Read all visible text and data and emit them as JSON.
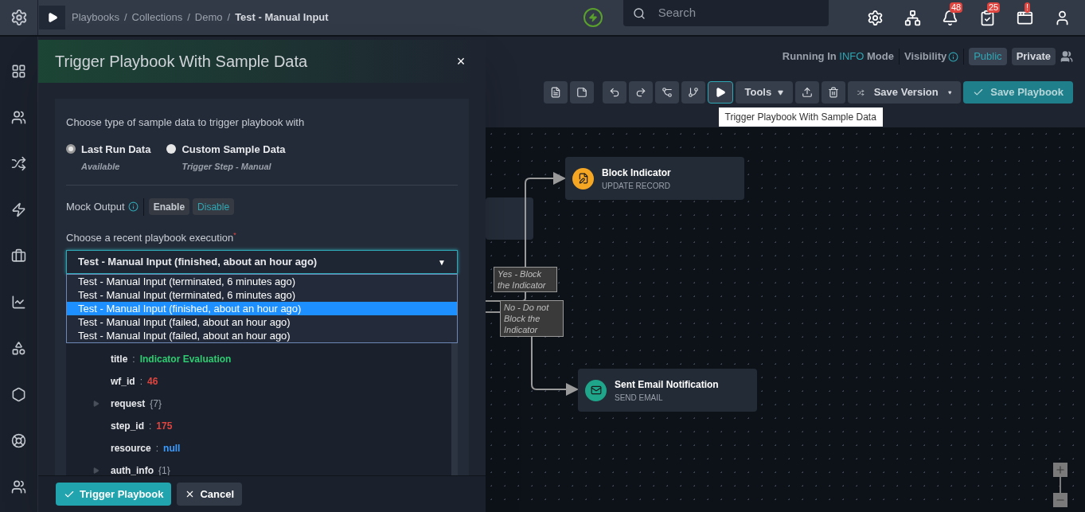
{
  "breadcrumb": [
    {
      "label": "Playbooks"
    },
    {
      "sep": "/",
      "label": "Collections"
    },
    {
      "sep": "/",
      "label": "Demo"
    },
    {
      "sep": "/",
      "label": "Test - Manual Input"
    }
  ],
  "search": {
    "placeholder": "Search"
  },
  "header_icons": [
    {
      "kind": "settings"
    },
    {
      "kind": "hierarchy"
    },
    {
      "kind": "bell",
      "badge": "48"
    },
    {
      "kind": "tasks",
      "badge": "25"
    },
    {
      "kind": "window-settings",
      "badge": "!"
    },
    {
      "kind": "user"
    }
  ],
  "mode": {
    "prefix": "Running In",
    "level": "INFO",
    "suffix": "Mode"
  },
  "visibility": {
    "label": "Visibility",
    "options": [
      {
        "label": "Public",
        "selected": true
      },
      {
        "label": "Private",
        "selected": false
      }
    ]
  },
  "toolbar": {
    "tools": "Tools",
    "save_version": "Save Version",
    "save_playbook": "Save Playbook",
    "tooltip": "Trigger Playbook With Sample Data"
  },
  "modal": {
    "title": "Trigger Playbook With Sample Data",
    "close": "×",
    "prompt": "Choose type of sample data to trigger playbook with",
    "sample_types": [
      {
        "label": "Last Run Data",
        "sub": "Available",
        "selected": true
      },
      {
        "label": "Custom Sample Data",
        "sub": "Trigger Step - Manual",
        "selected": false
      }
    ],
    "mock_output": {
      "label": "Mock Output",
      "options": [
        {
          "label": "Enable",
          "selected": false
        },
        {
          "label": "Disable",
          "selected": true
        }
      ]
    },
    "execution": {
      "label": "Choose a recent playbook execution",
      "required_mark": "*",
      "value": "Test - Manual Input (finished, about an hour ago)",
      "caret": "▼",
      "options": [
        {
          "label": "Test - Manual Input (terminated, 6 minutes ago)",
          "selected": false
        },
        {
          "label": "Test - Manual Input (terminated, 6 minutes ago)",
          "selected": false
        },
        {
          "label": "Test - Manual Input (finished, about an hour ago)",
          "selected": true
        },
        {
          "label": "Test - Manual Input (failed, about an hour ago)",
          "selected": false
        },
        {
          "label": "Test - Manual Input (failed, about an hour ago)",
          "selected": false
        }
      ]
    },
    "tree": [
      {
        "key": "title",
        "kind": "string",
        "sep": ":",
        "value": "Indicator Evaluation"
      },
      {
        "key": "wf_id",
        "kind": "number",
        "sep": ":",
        "value": "46"
      },
      {
        "key": "request",
        "kind": "object",
        "count": "{7}"
      },
      {
        "key": "step_id",
        "kind": "number",
        "sep": ":",
        "value": "175"
      },
      {
        "key": "resource",
        "kind": "null",
        "sep": ":",
        "value": "null"
      },
      {
        "key": "auth_info",
        "kind": "object",
        "count": "{1}"
      }
    ],
    "buttons": {
      "trigger": "Trigger Playbook",
      "cancel": "Cancel"
    }
  },
  "canvas": {
    "nodes": [
      {
        "title": "Block Indicator",
        "subtitle": "UPDATE RECORD",
        "color": "#f5a623",
        "kind": "record"
      },
      {
        "title": "Sent Email Notification",
        "subtitle": "SEND EMAIL",
        "color": "#1fa58a",
        "kind": "email"
      }
    ],
    "edge_labels": [
      "Yes - Block the Indicator",
      "No - Do not Block the Indicator"
    ]
  }
}
